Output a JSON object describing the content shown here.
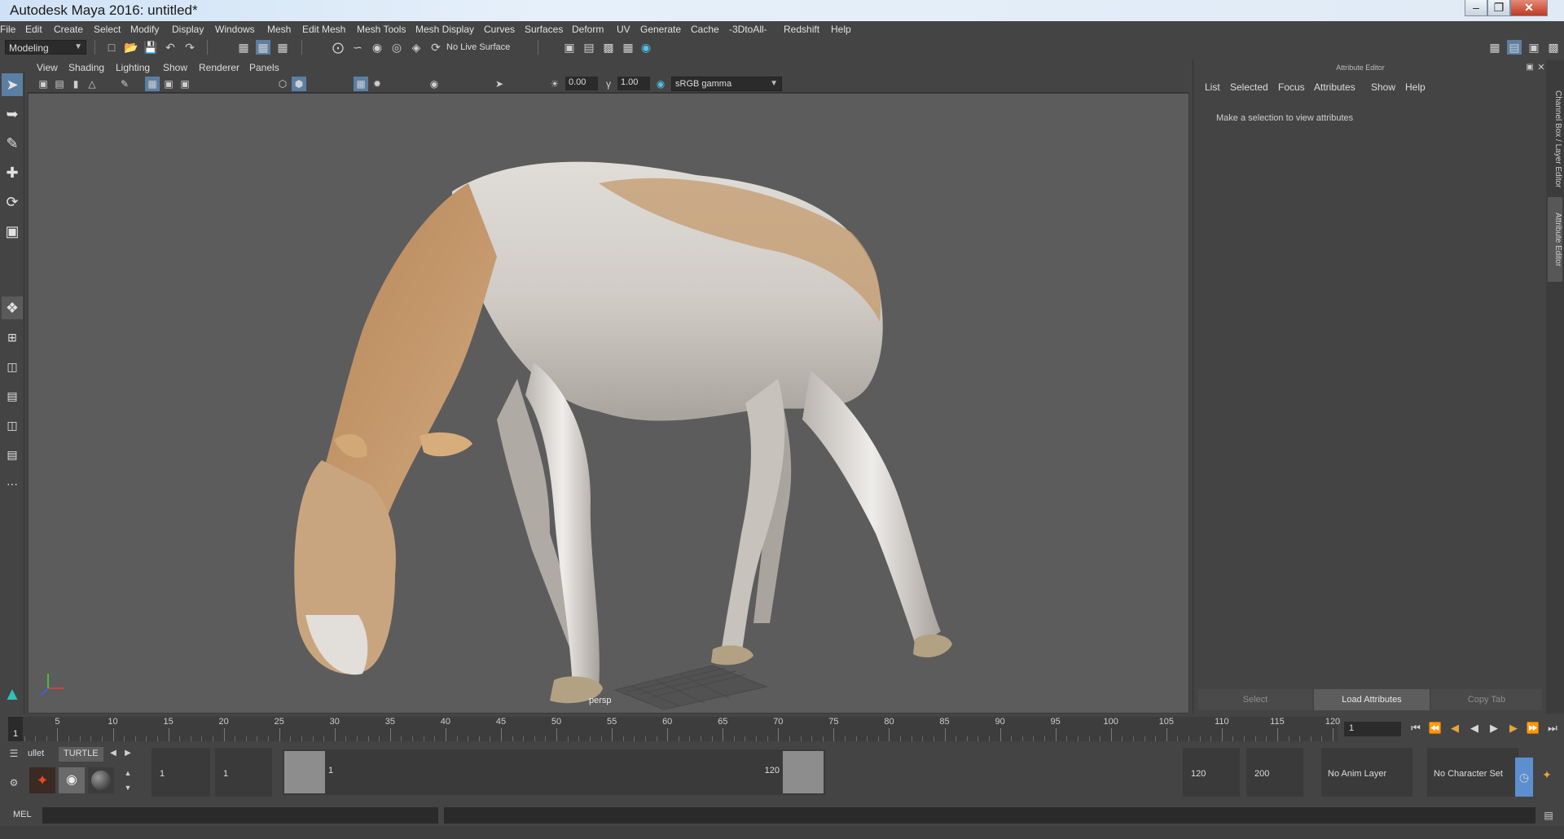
{
  "window": {
    "title": "Autodesk Maya 2016: untitled*"
  },
  "menubar": {
    "items": [
      "File",
      "Edit",
      "Create",
      "Select",
      "Modify",
      "Display",
      "Windows",
      "Mesh",
      "Edit Mesh",
      "Mesh Tools",
      "Mesh Display",
      "Curves",
      "Surfaces",
      "Deform",
      "UV",
      "Generate",
      "Cache",
      "-3DtoAll-",
      "Redshift",
      "Help"
    ]
  },
  "statusline": {
    "menuset": "Modeling",
    "live_surface": "No Live Surface"
  },
  "panel": {
    "menu": [
      "View",
      "Shading",
      "Lighting",
      "Show",
      "Renderer",
      "Panels"
    ],
    "exposure": "0.00",
    "gamma": "1.00",
    "color_space": "sRGB gamma",
    "camera": "persp"
  },
  "attribute_editor": {
    "title": "Attribute Editor",
    "menu": [
      "List",
      "Selected",
      "Focus",
      "Attributes",
      "Show",
      "Help"
    ],
    "empty_message": "Make a selection to view attributes",
    "buttons": [
      "Select",
      "Load Attributes",
      "Copy Tab"
    ]
  },
  "side_tabs": {
    "channel_box": "Channel Box / Layer Editor",
    "attribute_editor": "Attribute Editor"
  },
  "timeline": {
    "start": 1,
    "ticks": [
      5,
      10,
      15,
      20,
      25,
      30,
      35,
      40,
      45,
      50,
      55,
      60,
      65,
      70,
      75,
      80,
      85,
      90,
      95,
      100,
      105,
      110,
      115,
      120
    ],
    "current_frame": "1",
    "current_frame_field": "1"
  },
  "range": {
    "start": "1",
    "playback_start": "1",
    "inner_start": "1",
    "inner_end": "120",
    "playback_end": "120",
    "end": "200",
    "anim_layer": "No Anim Layer",
    "character_set": "No Character Set"
  },
  "shelf": {
    "tabs": [
      "ullet",
      "TURTLE"
    ]
  },
  "command_line": {
    "label": "MEL"
  },
  "colors": {
    "accent": "#5b7fa3",
    "viewport_bg": "#5c5c5c",
    "ui_bg": "#444444",
    "key_marker": "#e6a43a"
  }
}
